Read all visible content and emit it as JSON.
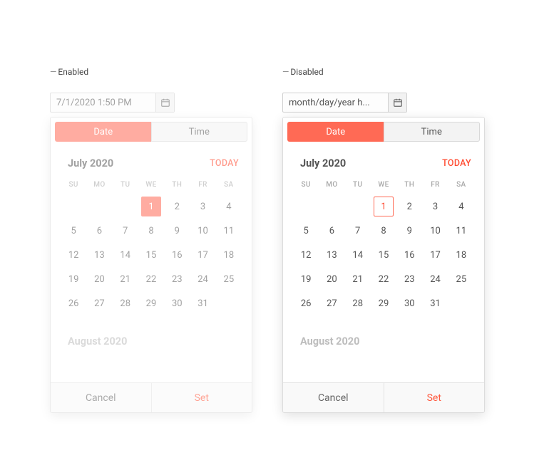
{
  "accent_color": "#ff6a55",
  "enabled": {
    "state_label": "Enabled",
    "input_value": "7/1/2020 1:50 PM",
    "tabs": {
      "date": "Date",
      "time": "Time"
    },
    "month_title": "July 2020",
    "today_label": "TODAY",
    "dow": [
      "SU",
      "MO",
      "TU",
      "WE",
      "TH",
      "FR",
      "SA"
    ],
    "weeks": [
      [
        "",
        "",
        "",
        "1",
        "2",
        "3",
        "4"
      ],
      [
        "5",
        "6",
        "7",
        "8",
        "9",
        "10",
        "11"
      ],
      [
        "12",
        "13",
        "14",
        "15",
        "16",
        "17",
        "18"
      ],
      [
        "19",
        "20",
        "21",
        "22",
        "23",
        "24",
        "25"
      ],
      [
        "26",
        "27",
        "28",
        "29",
        "30",
        "31",
        ""
      ]
    ],
    "selected_day": "1",
    "next_month_title": "August 2020",
    "cancel_label": "Cancel",
    "set_label": "Set"
  },
  "disabled": {
    "state_label": "Disabled",
    "input_value": "month/day/year h...",
    "tabs": {
      "date": "Date",
      "time": "Time"
    },
    "month_title": "July 2020",
    "today_label": "TODAY",
    "dow": [
      "SU",
      "MO",
      "TU",
      "WE",
      "TH",
      "FR",
      "SA"
    ],
    "weeks": [
      [
        "",
        "",
        "",
        "1",
        "2",
        "3",
        "4"
      ],
      [
        "5",
        "6",
        "7",
        "8",
        "9",
        "10",
        "11"
      ],
      [
        "12",
        "13",
        "14",
        "15",
        "16",
        "17",
        "18"
      ],
      [
        "19",
        "20",
        "21",
        "22",
        "23",
        "24",
        "25"
      ],
      [
        "26",
        "27",
        "28",
        "29",
        "30",
        "31",
        ""
      ]
    ],
    "selected_day": "1",
    "next_month_title": "August 2020",
    "cancel_label": "Cancel",
    "set_label": "Set"
  }
}
